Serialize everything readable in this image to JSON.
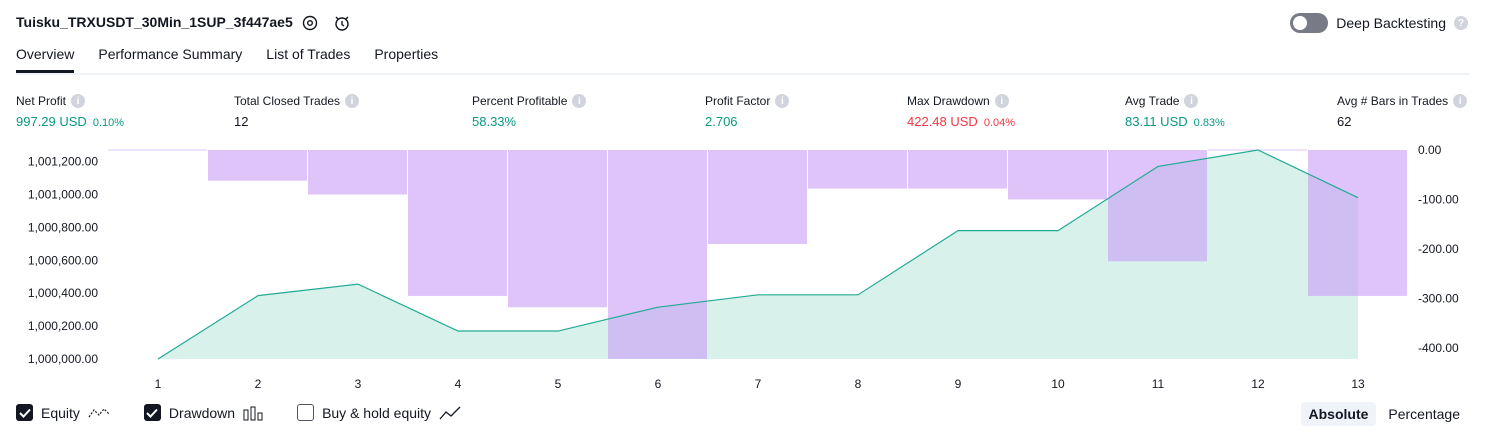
{
  "header": {
    "title": "Tuisku_TRXUSDT_30Min_1SUP_3f447ae5",
    "deep_backtesting_label": "Deep Backtesting",
    "deep_backtesting_on": false
  },
  "tabs": [
    {
      "label": "Overview",
      "active": true
    },
    {
      "label": "Performance Summary",
      "active": false
    },
    {
      "label": "List of Trades",
      "active": false
    },
    {
      "label": "Properties",
      "active": false
    }
  ],
  "metrics": [
    {
      "label": "Net Profit",
      "value": "997.29 USD",
      "sub": "0.10%",
      "tone": "green"
    },
    {
      "label": "Total Closed Trades",
      "value": "12",
      "sub": "",
      "tone": "dark"
    },
    {
      "label": "Percent Profitable",
      "value": "58.33%",
      "sub": "",
      "tone": "green"
    },
    {
      "label": "Profit Factor",
      "value": "2.706",
      "sub": "",
      "tone": "green"
    },
    {
      "label": "Max Drawdown",
      "value": "422.48 USD",
      "sub": "0.04%",
      "tone": "red"
    },
    {
      "label": "Avg Trade",
      "value": "83.11 USD",
      "sub": "0.83%",
      "tone": "green"
    },
    {
      "label": "Avg # Bars in Trades",
      "value": "62",
      "sub": "",
      "tone": "dark"
    }
  ],
  "chart_data": {
    "type": "area",
    "x": [
      1,
      2,
      3,
      4,
      5,
      6,
      7,
      8,
      9,
      10,
      11,
      12,
      13
    ],
    "left_axis_ticks": [
      "1,001,200.00",
      "1,001,000.00",
      "1,000,800.00",
      "1,000,600.00",
      "1,000,400.00",
      "1,000,200.00",
      "1,000,000.00"
    ],
    "right_axis_ticks": [
      "0.00",
      "-100.00",
      "-200.00",
      "-300.00",
      "-400.00"
    ],
    "ylim_left": [
      1000000,
      1001270
    ],
    "ylim_right": [
      -422.48,
      0
    ],
    "series": [
      {
        "name": "Equity",
        "axis": "left",
        "values": [
          1000000,
          1000385,
          1000455,
          1000170,
          1000170,
          1000315,
          1000390,
          1000390,
          1000780,
          1000780,
          1001170,
          1001270,
          1000980
        ]
      },
      {
        "name": "Drawdown",
        "axis": "right",
        "values": [
          0,
          -62,
          -90,
          -295,
          -318,
          -422.48,
          -190,
          -78,
          -78,
          -100,
          -225,
          0,
          -295
        ]
      }
    ],
    "colors": {
      "equity_line": "#22ab94",
      "equity_fill": "#d8f1ea",
      "drawdown_bar": "#e1c5fb",
      "overlap": "#b1b7e8",
      "axis_text": "#131722"
    },
    "grid": false
  },
  "legend": [
    {
      "label": "Equity",
      "checked": true,
      "icon": "equity-line-icon"
    },
    {
      "label": "Drawdown",
      "checked": true,
      "icon": "bar-chart-icon"
    },
    {
      "label": "Buy & hold equity",
      "checked": false,
      "icon": "trend-line-icon"
    }
  ],
  "mode": {
    "options": [
      "Absolute",
      "Percentage"
    ],
    "selected": "Absolute"
  }
}
